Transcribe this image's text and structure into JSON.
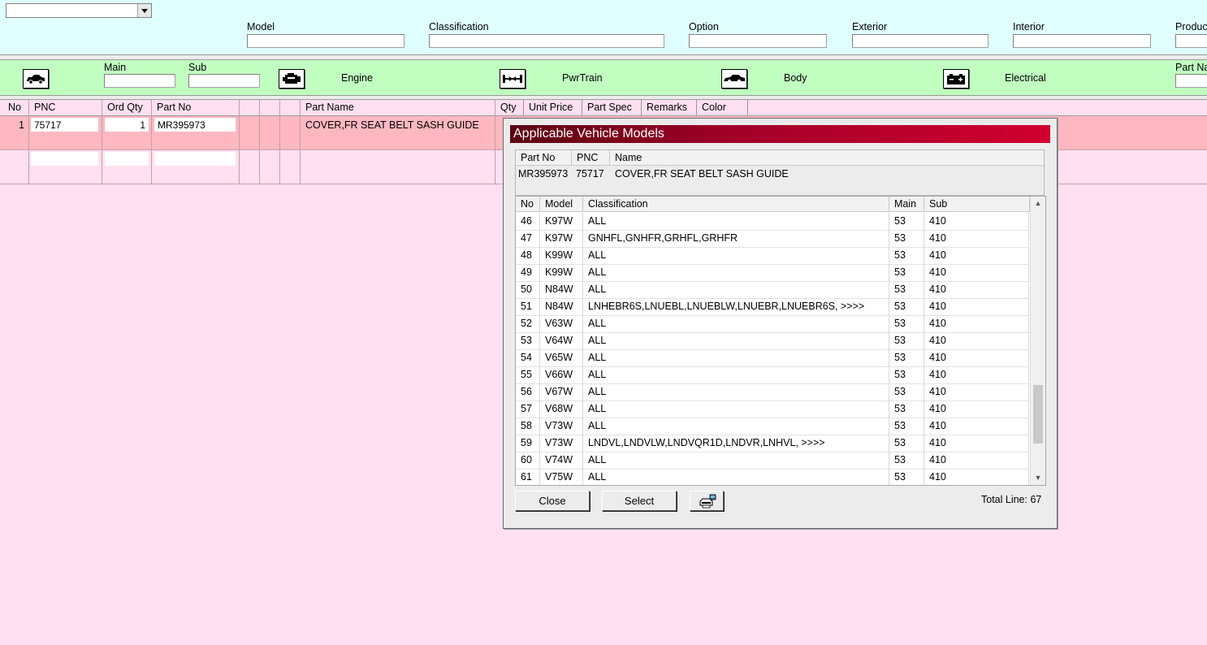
{
  "filters": {
    "dropdown_value": "",
    "labels": [
      "Model",
      "Classification",
      "Option",
      "Exterior",
      "Interior",
      "Produc"
    ],
    "values": [
      "",
      "",
      "",
      "",
      "",
      ""
    ]
  },
  "categories": {
    "main_label": "Main",
    "sub_label": "Sub",
    "main_value": "",
    "sub_value": "",
    "items": [
      {
        "label": "Engine",
        "icon": "engine-icon"
      },
      {
        "label": "PwrTrain",
        "icon": "powertrain-icon"
      },
      {
        "label": "Body",
        "icon": "body-icon"
      },
      {
        "label": "Electrical",
        "icon": "battery-icon"
      }
    ],
    "part_name_label": "Part Na",
    "part_name_value": ""
  },
  "parts_table": {
    "headers": [
      "No",
      "PNC",
      "Ord Qty",
      "Part No",
      "",
      "",
      "Part Name",
      "Qty",
      "Unit Price",
      "Part Spec",
      "Remarks",
      "Color"
    ],
    "rows": [
      {
        "no": "1",
        "pnc": "75717",
        "ord_qty": "1",
        "part_no": "MR395973",
        "part_name": "COVER,FR SEAT BELT SASH GUIDE"
      }
    ]
  },
  "dialog": {
    "title": "Applicable Vehicle Models",
    "info_headers": [
      "Part No",
      "PNC",
      "Name"
    ],
    "info": {
      "part_no": "MR395973",
      "pnc": "75717",
      "name": "COVER,FR SEAT BELT SASH GUIDE"
    },
    "list_headers": [
      "No",
      "Model",
      "Classification",
      "Main",
      "Sub"
    ],
    "rows": [
      {
        "no": "46",
        "model": "K97W",
        "classification": "ALL",
        "main": "53",
        "sub": "410"
      },
      {
        "no": "47",
        "model": "K97W",
        "classification": "GNHFL,GNHFR,GRHFL,GRHFR",
        "main": "53",
        "sub": "410"
      },
      {
        "no": "48",
        "model": "K99W",
        "classification": "ALL",
        "main": "53",
        "sub": "410"
      },
      {
        "no": "49",
        "model": "K99W",
        "classification": "ALL",
        "main": "53",
        "sub": "410"
      },
      {
        "no": "50",
        "model": "N84W",
        "classification": "ALL",
        "main": "53",
        "sub": "410"
      },
      {
        "no": "51",
        "model": "N84W",
        "classification": "LNHEBR6S,LNUEBL,LNUEBLW,LNUEBR,LNUEBR6S,  >>>>",
        "main": "53",
        "sub": "410"
      },
      {
        "no": "52",
        "model": "V63W",
        "classification": "ALL",
        "main": "53",
        "sub": "410"
      },
      {
        "no": "53",
        "model": "V64W",
        "classification": "ALL",
        "main": "53",
        "sub": "410"
      },
      {
        "no": "54",
        "model": "V65W",
        "classification": "ALL",
        "main": "53",
        "sub": "410"
      },
      {
        "no": "55",
        "model": "V66W",
        "classification": "ALL",
        "main": "53",
        "sub": "410"
      },
      {
        "no": "56",
        "model": "V67W",
        "classification": "ALL",
        "main": "53",
        "sub": "410"
      },
      {
        "no": "57",
        "model": "V68W",
        "classification": "ALL",
        "main": "53",
        "sub": "410"
      },
      {
        "no": "58",
        "model": "V73W",
        "classification": "ALL",
        "main": "53",
        "sub": "410"
      },
      {
        "no": "59",
        "model": "V73W",
        "classification": "LNDVL,LNDVLW,LNDVQR1D,LNDVR,LNHVL,  >>>>",
        "main": "53",
        "sub": "410"
      },
      {
        "no": "60",
        "model": "V74W",
        "classification": "ALL",
        "main": "53",
        "sub": "410"
      },
      {
        "no": "61",
        "model": "V75W",
        "classification": "ALL",
        "main": "53",
        "sub": "410"
      }
    ],
    "buttons": {
      "close": "Close",
      "select": "Select",
      "print_icon": "printer-icon"
    },
    "total_line": "Total Line: 67"
  },
  "colors": {
    "filter_bar": "#e0ffff",
    "category_bar": "#c0ffc0",
    "table_bg": "#ffe0f0",
    "selected_row": "#ffb8c0",
    "dialog_title_start": "#5a0010",
    "dialog_title_end": "#d00030"
  }
}
